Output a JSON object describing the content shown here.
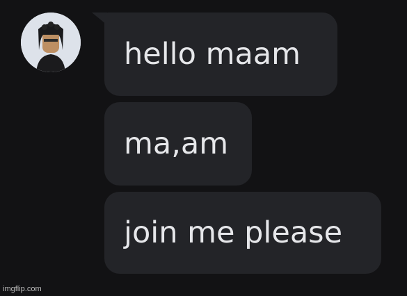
{
  "conversation": {
    "messages": [
      {
        "text": "hello maam"
      },
      {
        "text": "ma,am"
      },
      {
        "text": "join me please"
      }
    ]
  },
  "watermark": "imgflip.com"
}
